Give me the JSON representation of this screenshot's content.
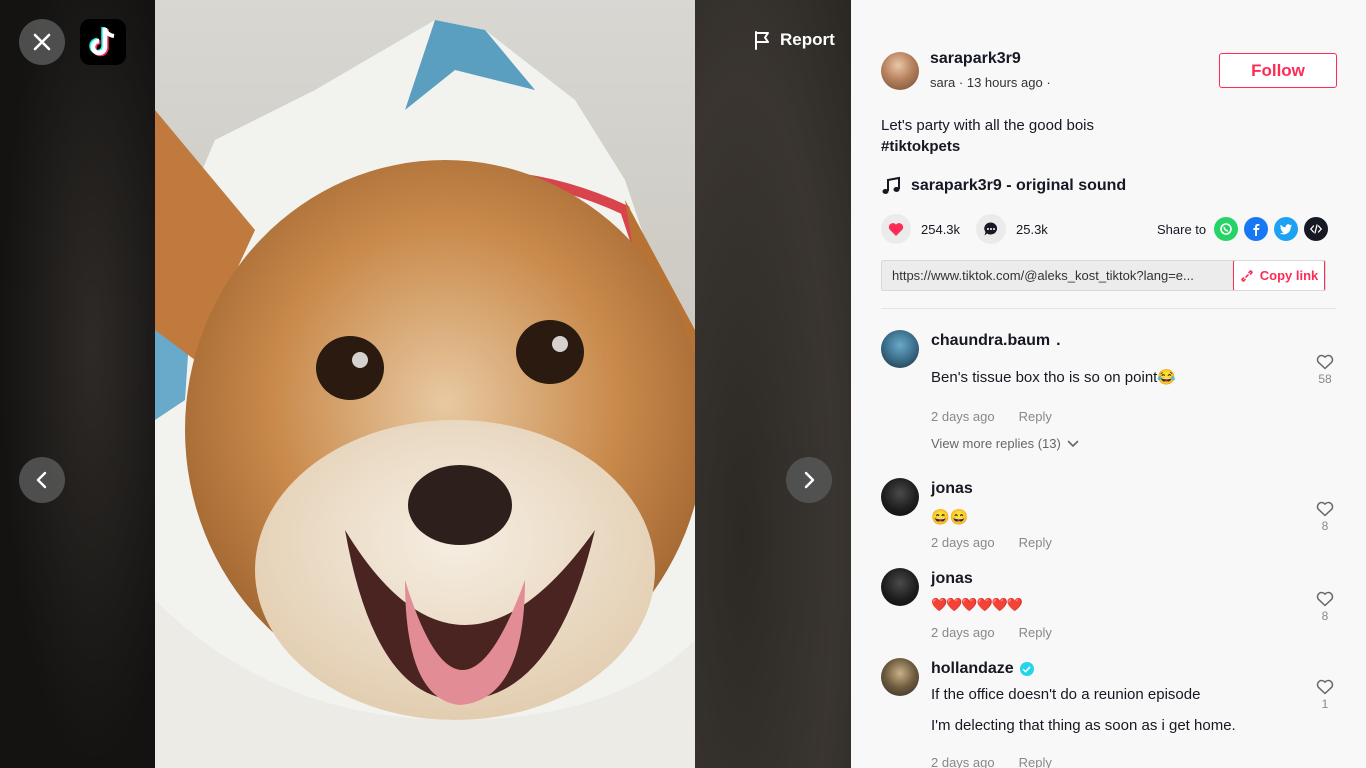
{
  "topbar": {
    "report_label": "Report"
  },
  "author": {
    "username": "sarapark3r9",
    "meta": "sara · 13 hours ago ·",
    "follow_label": "Follow"
  },
  "post": {
    "caption": "Let's party with all the good bois",
    "hashtag": "#tiktokpets",
    "sound": "sarapark3r9 - original sound",
    "likes": "254.3k",
    "comments": "25.3k",
    "share_label": "Share to",
    "url": "https://www.tiktok.com/@aleks_kost_tiktok?lang=e...",
    "copy_label": "Copy link"
  },
  "comments": [
    {
      "name": "chaundra.baum",
      "suffix": ".",
      "text": "Ben's tissue box tho is so on point😂",
      "time": "2 days ago",
      "reply": "Reply",
      "likes": "58",
      "more_replies": "View more replies (13)"
    },
    {
      "name": "jonas",
      "text": "😄😄",
      "time": "2 days ago",
      "reply": "Reply",
      "likes": "8"
    },
    {
      "name": "jonas",
      "text": "❤️❤️❤️❤️❤️❤️",
      "time": "2 days ago",
      "reply": "Reply",
      "likes": "8"
    },
    {
      "name": "hollandaze",
      "text": "If the office doesn't do a reunion episode",
      "text2": "I'm delecting that thing as soon as i get home.",
      "time": "2 days ago",
      "reply": "Reply",
      "likes": "1"
    }
  ],
  "colors": {
    "accent": "#fe2c55",
    "whatsapp": "#25d366",
    "facebook": "#1877f2",
    "twitter": "#1da1f2",
    "verified": "#20d5ec"
  }
}
